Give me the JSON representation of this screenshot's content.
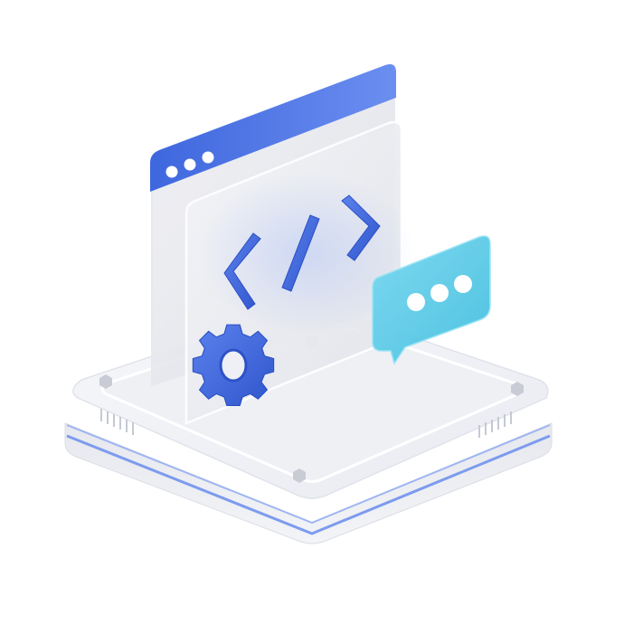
{
  "illustration": {
    "subject": "3d-code-window-icon",
    "window_dots": 3,
    "chat_dots": 3,
    "icons": [
      "code-brackets-icon",
      "gear-icon",
      "chat-bubble-icon"
    ],
    "colors": {
      "background": "#ffffff",
      "blue_accent": "#4a73e0",
      "blue_dark": "#3358c9",
      "cyan_bubble": "#5ccde8",
      "panel_light": "#eceef3",
      "base_top": "#f1f2f6",
      "base_side": "#e3e5ec",
      "stripe": "#7d9bee"
    }
  }
}
